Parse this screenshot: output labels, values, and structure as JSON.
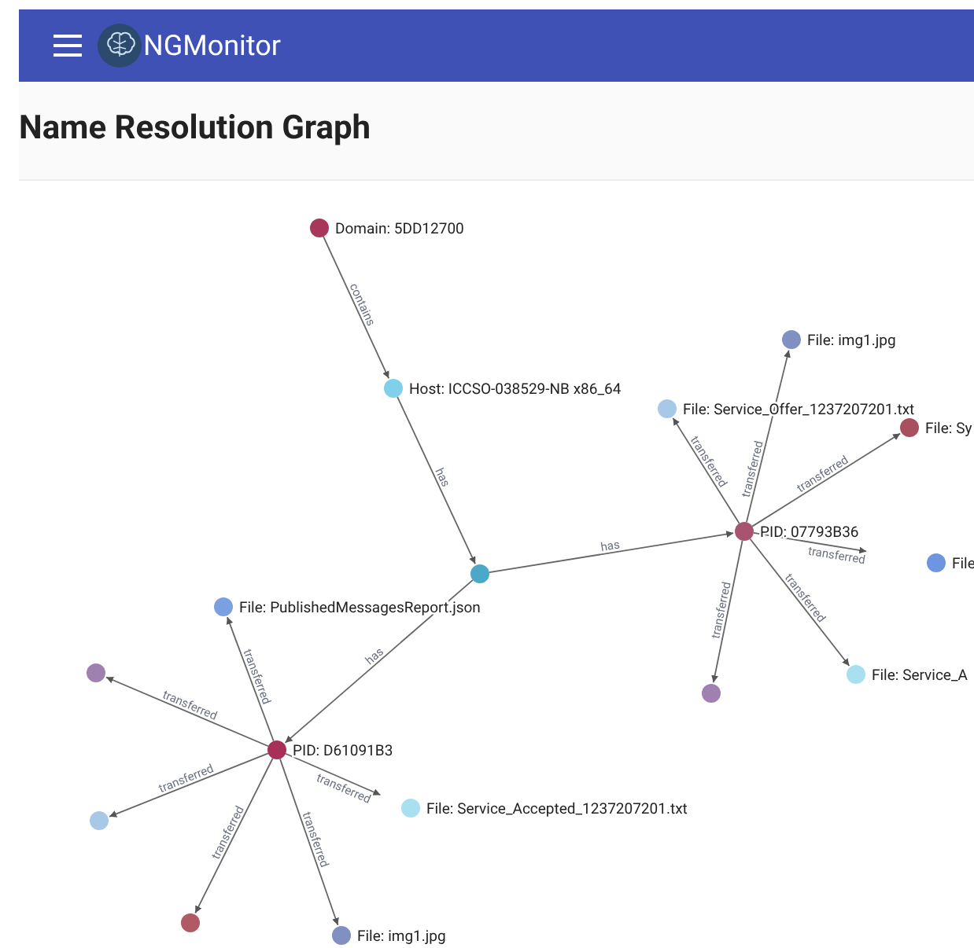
{
  "app_bar": {
    "title": "NGMonitor"
  },
  "page": {
    "title": "Name Resolution Graph"
  },
  "graph": {
    "nodes": [
      {
        "label": "Domain: 5DD12700",
        "color": "#a8385a"
      },
      {
        "label": "File: img1.jpg",
        "color": "#8090c0"
      },
      {
        "label": "Host: ICCSO-038529-NB x86_64",
        "color": "#7fd0e8"
      },
      {
        "label": "File: Service_Offer_1237207201.txt",
        "color": "#a8c8e8"
      },
      {
        "label": "File: Sy",
        "color": "#a85060"
      },
      {
        "label": "PID: 07793B36",
        "color": "#a85370"
      },
      {
        "label": "File",
        "color": "#6e96e0"
      },
      {
        "color": "#4aa8c8"
      },
      {
        "label": "File: PublishedMessagesReport.json",
        "color": "#7aa0e0"
      },
      {
        "color": "#a080b0"
      },
      {
        "label": "File: Service_A",
        "color": "#a8e0f0"
      },
      {
        "color": "#a080b0"
      },
      {
        "label": "PID: D61091B3",
        "color": "#a83058"
      },
      {
        "label": "File: Service_Accepted_1237207201.txt",
        "color": "#a8e0f0"
      },
      {
        "color": "#a8c8e8"
      },
      {
        "color": "#b05a64"
      },
      {
        "label": "File: img1.jpg",
        "color": "#8090c0"
      }
    ],
    "edges": [
      {
        "label": "contains"
      },
      {
        "label": "has"
      },
      {
        "label": "has"
      },
      {
        "label": "has"
      },
      {
        "label": "transferred"
      },
      {
        "label": "transferred"
      },
      {
        "label": "transferred"
      },
      {
        "label": "transferred"
      },
      {
        "label": "transferred"
      },
      {
        "label": "transferred"
      },
      {
        "label": "transferred"
      },
      {
        "label": "transferred"
      },
      {
        "label": "transferred"
      },
      {
        "label": "transferred"
      },
      {
        "label": "transferred"
      },
      {
        "label": "transferred"
      }
    ]
  }
}
